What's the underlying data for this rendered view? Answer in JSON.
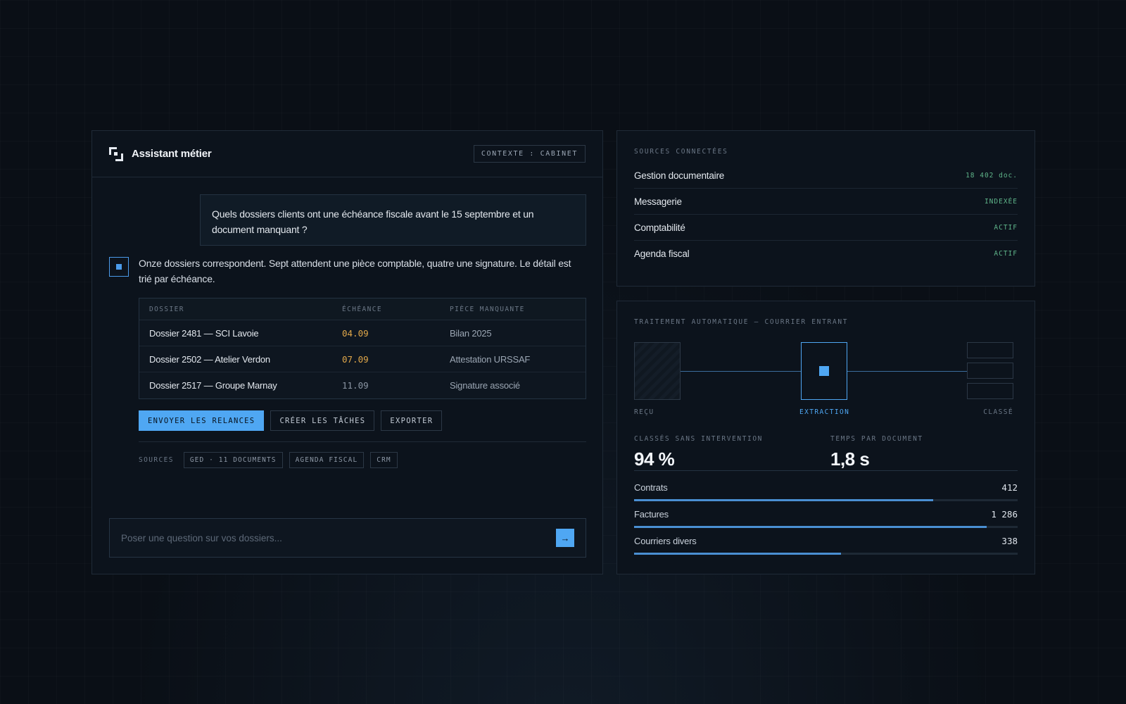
{
  "assistant": {
    "title": "Assistant métier",
    "context": "CONTEXTE : CABINET",
    "user_message": "Quels dossiers clients ont une échéance fiscale avant le 15 septembre et un document manquant ?",
    "bot_message": "Onze dossiers correspondent. Sept attendent une pièce comptable, quatre une signature. Le détail est trié par échéance.",
    "table": {
      "headers": [
        "DOSSIER",
        "ÉCHÉANCE",
        "PIÈCE MANQUANTE"
      ],
      "rows": [
        {
          "dossier": "Dossier 2481 — SCI Lavoie",
          "echeance": "04.09",
          "piece": "Bilan 2025",
          "color": "#e0a74a"
        },
        {
          "dossier": "Dossier 2502 — Atelier Verdon",
          "echeance": "07.09",
          "piece": "Attestation URSSAF",
          "color": "#e0a74a"
        },
        {
          "dossier": "Dossier 2517 — Groupe Marnay",
          "echeance": "11.09",
          "piece": "Signature associé",
          "color": "#8b96a4"
        }
      ]
    },
    "actions": {
      "send_reminders": "ENVOYER LES RELANCES",
      "create_tasks": "CRÉER LES TÂCHES",
      "export": "EXPORTER"
    },
    "sources_label": "SOURCES",
    "sources_chips": [
      "GED · 11 DOCUMENTS",
      "AGENDA FISCAL",
      "CRM"
    ],
    "input_placeholder": "Poser une question sur vos dossiers..."
  },
  "connected_sources": {
    "title": "SOURCES CONNECTÉES",
    "items": [
      {
        "name": "Gestion documentaire",
        "status": "18 402 doc."
      },
      {
        "name": "Messagerie",
        "status": "INDEXÉE"
      },
      {
        "name": "Comptabilité",
        "status": "ACTIF"
      },
      {
        "name": "Agenda fiscal",
        "status": "ACTIF"
      }
    ]
  },
  "pipeline": {
    "title": "TRAITEMENT AUTOMATIQUE — COURRIER ENTRANT",
    "stages": [
      "REÇU",
      "EXTRACTION",
      "CLASSÉ"
    ],
    "active_stage": "EXTRACTION",
    "metrics": [
      {
        "label": "CLASSÉS SANS INTERVENTION",
        "value": "94 %"
      },
      {
        "label": "TEMPS PAR DOCUMENT",
        "value": "1,8 s"
      }
    ],
    "categories": [
      {
        "name": "Contrats",
        "value": "412",
        "fill": 0.78
      },
      {
        "name": "Factures",
        "value": "1 286",
        "fill": 0.92
      },
      {
        "name": "Courriers divers",
        "value": "338",
        "fill": 0.54
      }
    ],
    "accent_color": "#4fa7f3"
  }
}
